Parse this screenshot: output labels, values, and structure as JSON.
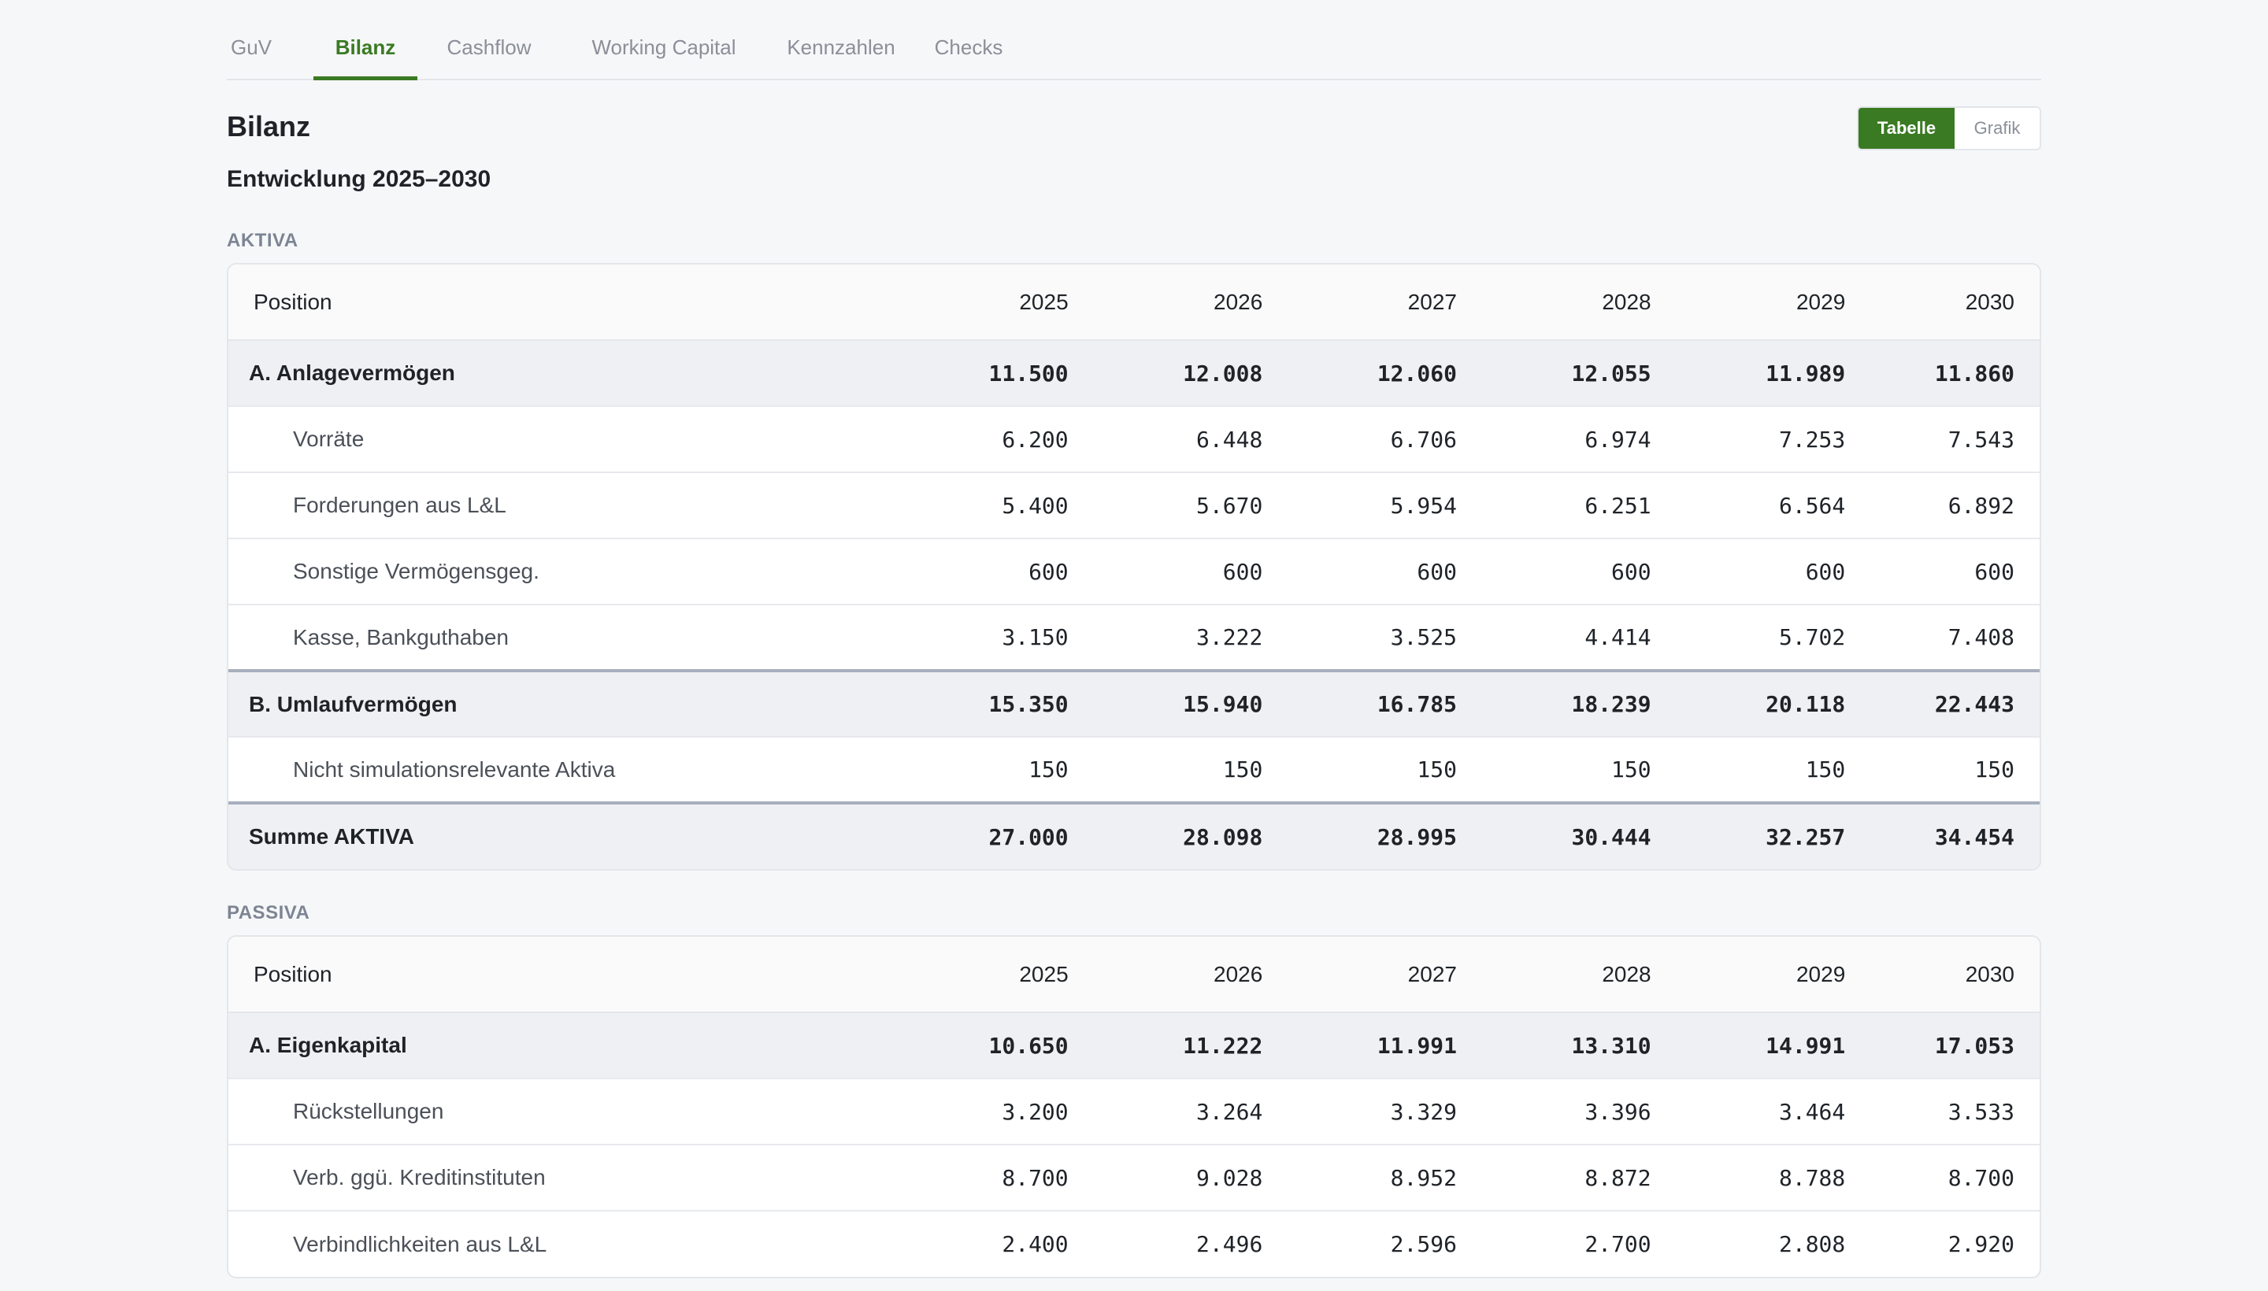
{
  "tabs": [
    "GuV",
    "Bilanz",
    "Cashflow",
    "Working Capital",
    "Kennzahlen",
    "Checks"
  ],
  "active_tab": "Bilanz",
  "title": "Bilanz",
  "subtitle": "Entwicklung 2025–2030",
  "view_toggle": {
    "table_label": "Tabelle",
    "chart_label": "Grafik",
    "selected": "Tabelle"
  },
  "colors": {
    "accent": "#3a7a23",
    "sum_row_bg": "#eef0f4"
  },
  "aktiva": {
    "label": "AKTIVA",
    "header": [
      "Position",
      "2025",
      "2026",
      "2027",
      "2028",
      "2029",
      "2030"
    ],
    "rows": [
      {
        "type": "sum",
        "label": "A. Anlagevermögen",
        "values": [
          "11.500",
          "12.008",
          "12.060",
          "12.055",
          "11.989",
          "11.860"
        ]
      },
      {
        "type": "item",
        "label": "Vorräte",
        "values": [
          "6.200",
          "6.448",
          "6.706",
          "6.974",
          "7.253",
          "7.543"
        ]
      },
      {
        "type": "item",
        "label": "Forderungen aus L&L",
        "values": [
          "5.400",
          "5.670",
          "5.954",
          "6.251",
          "6.564",
          "6.892"
        ]
      },
      {
        "type": "item",
        "label": "Sonstige Vermögensgeg.",
        "values": [
          "600",
          "600",
          "600",
          "600",
          "600",
          "600"
        ]
      },
      {
        "type": "item",
        "label": "Kasse, Bankguthaben",
        "values": [
          "3.150",
          "3.222",
          "3.525",
          "4.414",
          "5.702",
          "7.408"
        ]
      },
      {
        "type": "sum",
        "topline": true,
        "label": "B. Umlaufvermögen",
        "values": [
          "15.350",
          "15.940",
          "16.785",
          "18.239",
          "20.118",
          "22.443"
        ]
      },
      {
        "type": "item",
        "label": "Nicht simulationsrelevante Aktiva",
        "values": [
          "150",
          "150",
          "150",
          "150",
          "150",
          "150"
        ]
      },
      {
        "type": "sum",
        "topline": true,
        "label": "Summe AKTIVA",
        "values": [
          "27.000",
          "28.098",
          "28.995",
          "30.444",
          "32.257",
          "34.454"
        ]
      }
    ]
  },
  "passiva": {
    "label": "PASSIVA",
    "header": [
      "Position",
      "2025",
      "2026",
      "2027",
      "2028",
      "2029",
      "2030"
    ],
    "rows": [
      {
        "type": "sum",
        "label": "A. Eigenkapital",
        "values": [
          "10.650",
          "11.222",
          "11.991",
          "13.310",
          "14.991",
          "17.053"
        ]
      },
      {
        "type": "item",
        "label": "Rückstellungen",
        "values": [
          "3.200",
          "3.264",
          "3.329",
          "3.396",
          "3.464",
          "3.533"
        ]
      },
      {
        "type": "item",
        "label": "Verb. ggü. Kreditinstituten",
        "values": [
          "8.700",
          "9.028",
          "8.952",
          "8.872",
          "8.788",
          "8.700"
        ]
      },
      {
        "type": "item",
        "label": "Verbindlichkeiten aus L&L",
        "values": [
          "2.400",
          "2.496",
          "2.596",
          "2.700",
          "2.808",
          "2.920"
        ]
      }
    ]
  }
}
